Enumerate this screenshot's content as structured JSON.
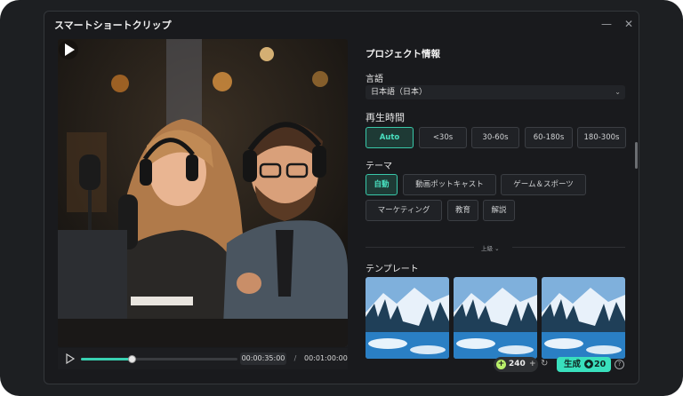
{
  "window": {
    "title": "スマートショートクリップ",
    "minimize_glyph": "—",
    "close_glyph": "✕"
  },
  "player": {
    "current_time": "00:00:35:00",
    "separator": "/",
    "total_time": "00:01:00:00",
    "progress": 0.33
  },
  "panel": {
    "heading": "プロジェクト情報",
    "language": {
      "label": "言語",
      "value": "日本語（日本）"
    },
    "duration": {
      "label": "再生時間",
      "options": [
        "Auto",
        "<30s",
        "30-60s",
        "60-180s",
        "180-300s"
      ],
      "selected": "Auto"
    },
    "theme": {
      "label": "テーマ",
      "options": [
        "自動",
        "動画ポットキャスト",
        "ゲーム＆スポーツ",
        "マーケティング",
        "教育",
        "解説"
      ],
      "selected": "自動"
    },
    "advanced": {
      "label": "上級"
    },
    "template": {
      "label": "テンプレート",
      "items": [
        "snowy-mountain-lake-1",
        "snowy-mountain-lake-2",
        "snowy-mountain-lake-3"
      ]
    }
  },
  "footer": {
    "credits": {
      "value": "240",
      "plus": "+"
    },
    "generate": {
      "label": "生成",
      "cost": "20"
    }
  },
  "colors": {
    "accent": "#39e0bd",
    "background": "#191a1d",
    "credit_icon": "#b9f06a"
  }
}
